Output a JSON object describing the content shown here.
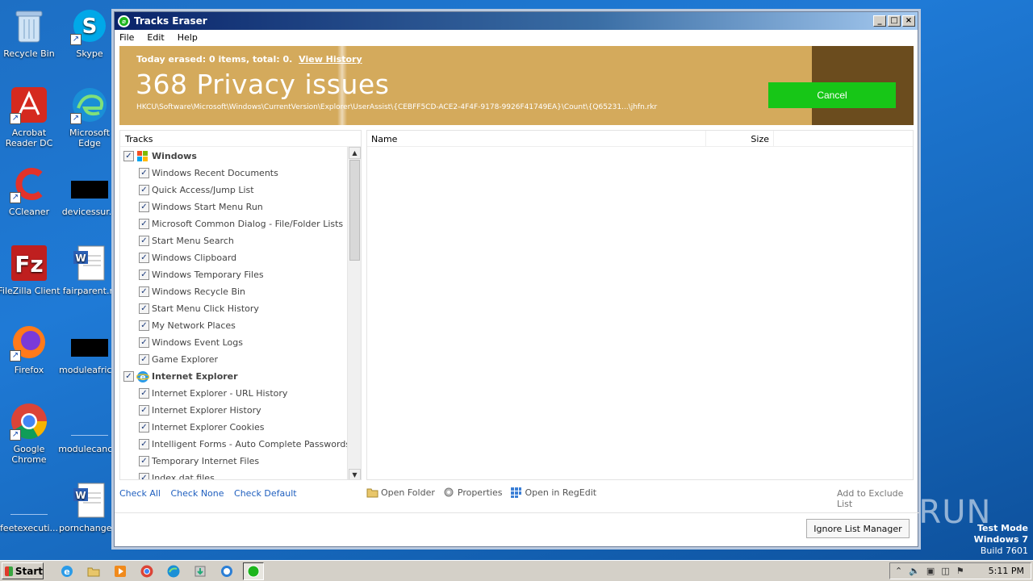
{
  "desktop": {
    "icons": [
      {
        "label": "Recycle Bin",
        "icon": "recycle-bin-icon"
      },
      {
        "label": "Skype",
        "icon": "skype-icon"
      },
      {
        "label": "Acrobat Reader DC",
        "icon": "acrobat-icon"
      },
      {
        "label": "Microsoft Edge",
        "icon": "edge-icon"
      },
      {
        "label": "CCleaner",
        "icon": "ccleaner-icon"
      },
      {
        "label": "devicessur...",
        "icon": "black-file-icon"
      },
      {
        "label": "FileZilla Client",
        "icon": "filezilla-icon"
      },
      {
        "label": "fairparent.rt",
        "icon": "word-doc-icon"
      },
      {
        "label": "Firefox",
        "icon": "firefox-icon"
      },
      {
        "label": "moduleafric...",
        "icon": "black-file-icon"
      },
      {
        "label": "Google Chrome",
        "icon": "chrome-icon"
      },
      {
        "label": "modulecanc...",
        "icon": "blank-file-icon"
      },
      {
        "label": "feetexecuti...",
        "icon": "blank-file-icon"
      },
      {
        "label": "pornchange...",
        "icon": "word-doc-icon"
      }
    ]
  },
  "window": {
    "title": "Tracks Eraser",
    "controls": {
      "minimize": "_",
      "maximize": "□",
      "close": "×"
    },
    "menu": [
      "File",
      "Edit",
      "Help"
    ]
  },
  "banner": {
    "today": "Today erased: 0 items, total: 0.",
    "view_history": "View History",
    "issues": "368 Privacy issues",
    "path": "HKCU\\Software\\Microsoft\\Windows\\CurrentVersion\\Explorer\\UserAssist\\{CEBFF5CD-ACE2-4F4F-9178-9926F41749EA}\\Count\\{Q65231...\\jhfn.rkr",
    "cancel": "Cancel",
    "colors": {
      "gold": "#d4aa5c",
      "dark": "#6b4c1e",
      "green": "#17c617"
    }
  },
  "tracks": {
    "header": "Tracks",
    "groups": [
      {
        "label": "Windows",
        "icon": "windows-logo-icon",
        "checked": true,
        "items": [
          "Windows Recent Documents",
          "Quick Access/Jump List",
          "Windows Start Menu Run",
          "Microsoft Common Dialog - File/Folder Lists",
          "Start Menu Search",
          "Windows Clipboard",
          "Windows Temporary Files",
          "Windows Recycle Bin",
          "Start Menu Click History",
          "My Network Places",
          "Windows Event Logs",
          "Game Explorer"
        ]
      },
      {
        "label": "Internet Explorer",
        "icon": "internet-explorer-icon",
        "checked": true,
        "items": [
          "Internet Explorer - URL History",
          "Internet Explorer History",
          "Internet Explorer Cookies",
          "Intelligent Forms - Auto Complete Passwords",
          "Temporary Internet Files",
          "Index.dat files"
        ]
      }
    ],
    "check_all": "Check All",
    "check_none": "Check None",
    "check_default": "Check Default"
  },
  "list": {
    "columns": {
      "name": "Name",
      "size": "Size"
    }
  },
  "actions": {
    "open_folder": "Open Folder",
    "properties": "Properties",
    "open_regedit": "Open in RegEdit",
    "add_exclude": "Add to Exclude List",
    "ignore_manager": "Ignore List Manager"
  },
  "taskbar": {
    "start": "Start",
    "clock": "5:11 PM"
  },
  "overlay": {
    "watermark": "ANY RUN",
    "test_mode": "Test Mode",
    "os": "Windows 7",
    "build": "Build 7601"
  }
}
